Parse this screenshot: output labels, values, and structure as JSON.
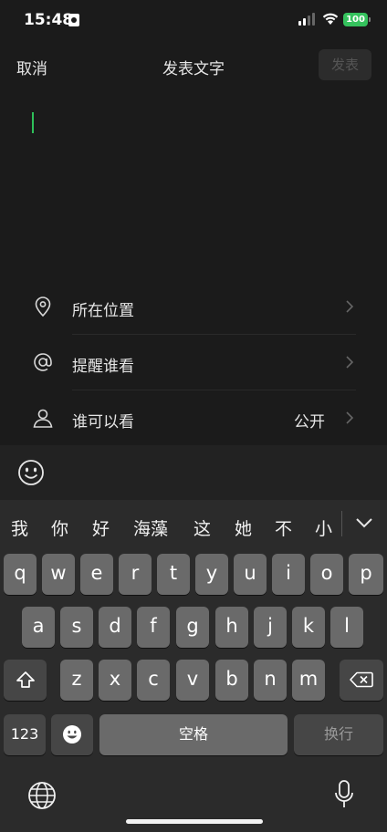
{
  "status_bar": {
    "time": "15:48",
    "battery": "100"
  },
  "nav": {
    "cancel": "取消",
    "title": "发表文字",
    "publish": "发表"
  },
  "options": [
    {
      "label": "所在位置",
      "value": "",
      "icon": "location-pin-icon"
    },
    {
      "label": "提醒谁看",
      "value": "",
      "icon": "at-sign-icon"
    },
    {
      "label": "谁可以看",
      "value": "公开",
      "icon": "person-icon"
    }
  ],
  "keyboard": {
    "candidates": [
      "我",
      "你",
      "好",
      "海藻",
      "这",
      "她",
      "不",
      "小"
    ],
    "row1": [
      "q",
      "w",
      "e",
      "r",
      "t",
      "y",
      "u",
      "i",
      "o",
      "p"
    ],
    "row2": [
      "a",
      "s",
      "d",
      "f",
      "g",
      "h",
      "j",
      "k",
      "l"
    ],
    "row3": [
      "z",
      "x",
      "c",
      "v",
      "b",
      "n",
      "m"
    ],
    "numbers_key": "123",
    "space_key": "空格",
    "return_key": "换行"
  },
  "colors": {
    "accent": "#2ebf5a",
    "battery": "#35c25d",
    "background": "#1b1b1b"
  }
}
